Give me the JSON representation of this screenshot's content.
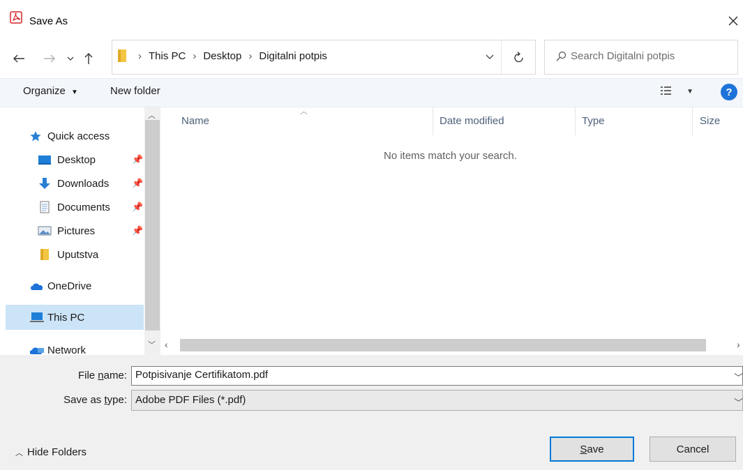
{
  "window": {
    "title": "Save As"
  },
  "address": {
    "parts": [
      "This PC",
      "Desktop",
      "Digitalni potpis"
    ]
  },
  "search": {
    "placeholder": "Search Digitalni potpis"
  },
  "commands": {
    "organize": "Organize",
    "new_folder": "New folder"
  },
  "nav": {
    "quick_access": "Quick access",
    "items": [
      {
        "label": "Desktop",
        "pinned": true
      },
      {
        "label": "Downloads",
        "pinned": true
      },
      {
        "label": "Documents",
        "pinned": true
      },
      {
        "label": "Pictures",
        "pinned": true
      },
      {
        "label": "Uputstva",
        "pinned": false
      }
    ],
    "onedrive": "OneDrive",
    "this_pc": "This PC",
    "network": "Network"
  },
  "columns": {
    "name": "Name",
    "date": "Date modified",
    "type": "Type",
    "size": "Size"
  },
  "list": {
    "empty": "No items match your search."
  },
  "form": {
    "filename_label_pre": "File ",
    "filename_label_u": "n",
    "filename_label_post": "ame:",
    "filename_value": "Potpisivanje Certifikatom.pdf",
    "type_label_pre": "Save as ",
    "type_label_u": "t",
    "type_label_post": "ype:",
    "type_value": "Adobe PDF Files (*.pdf)"
  },
  "footer": {
    "hide_folders": "Hide Folders",
    "save_u": "S",
    "save_rest": "ave",
    "cancel": "Cancel"
  },
  "colors": {
    "accent": "#0078d7",
    "selected": "#cce4f7",
    "help": "#1e73d8",
    "folder": "#f4c542"
  }
}
